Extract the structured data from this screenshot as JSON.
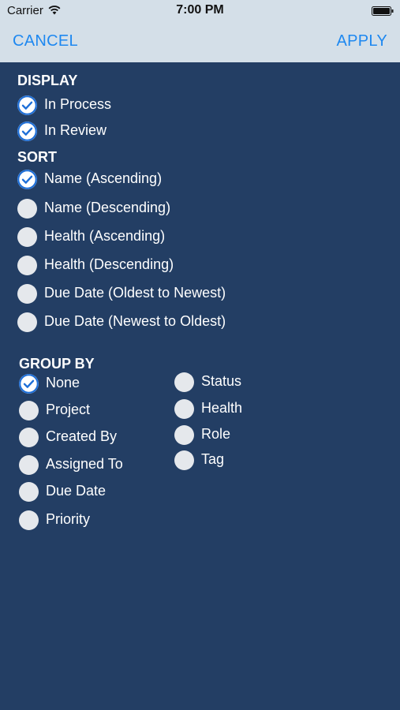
{
  "status_bar": {
    "carrier": "Carrier",
    "time": "7:00 PM"
  },
  "nav": {
    "cancel": "CANCEL",
    "apply": "APPLY"
  },
  "display": {
    "title": "DISPLAY",
    "options": [
      {
        "label": "In Process",
        "checked": true
      },
      {
        "label": "In Review",
        "checked": true
      }
    ]
  },
  "sort": {
    "title": "SORT",
    "options": [
      {
        "label": "Name (Ascending)",
        "checked": true
      },
      {
        "label": "Name (Descending)",
        "checked": false
      },
      {
        "label": "Health (Ascending)",
        "checked": false
      },
      {
        "label": "Health (Descending)",
        "checked": false
      },
      {
        "label": "Due Date (Oldest to Newest)",
        "checked": false
      },
      {
        "label": "Due Date (Newest to Oldest)",
        "checked": false
      }
    ]
  },
  "group_by": {
    "title": "GROUP BY",
    "left": [
      {
        "label": "None",
        "checked": true
      },
      {
        "label": "Project",
        "checked": false
      },
      {
        "label": "Created By",
        "checked": false
      },
      {
        "label": "Assigned To",
        "checked": false
      },
      {
        "label": "Due Date",
        "checked": false
      },
      {
        "label": "Priority",
        "checked": false
      }
    ],
    "right": [
      {
        "label": "Status",
        "checked": false
      },
      {
        "label": "Health",
        "checked": false
      },
      {
        "label": "Role",
        "checked": false
      },
      {
        "label": "Tag",
        "checked": false
      }
    ]
  },
  "colors": {
    "background": "#233e64",
    "topbar": "#d4dfe8",
    "accent": "#1e88f0"
  }
}
